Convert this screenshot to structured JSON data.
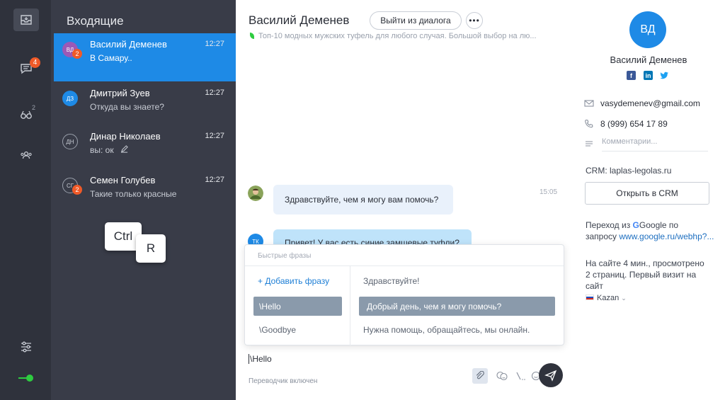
{
  "rail": {
    "chat_badge": "4",
    "visitors_sup": "2",
    "icons": [
      "inbox-icon",
      "chat-icon",
      "visitors-icon",
      "team-icon",
      "settings-sliders-icon"
    ]
  },
  "conversations": {
    "title": "Входящие",
    "items": [
      {
        "initials": "ВД",
        "badge": "2",
        "name": "Василий Деменев",
        "preview": "В Самару..",
        "time": "12:27"
      },
      {
        "initials": "ДЗ",
        "badge": "",
        "name": "Дмитрий Зуев",
        "preview": "Откуда вы знаете?",
        "time": "12:27"
      },
      {
        "initials": "ДН",
        "badge": "",
        "name": "Динар Николаев",
        "preview": "вы: ок",
        "time": "12:27"
      },
      {
        "initials": "СГ",
        "badge": "2",
        "name": "Семен Голубев",
        "preview": "Такие только красные",
        "time": "12:27"
      }
    ],
    "keys": [
      "Ctrl",
      "R"
    ]
  },
  "chat": {
    "name": "Василий Деменев",
    "exit_label": "Выйти из диалога",
    "more_label": "•••",
    "page_title": "Топ-10 модных мужских туфель для любого случая. Большой выбор на лю...",
    "messages": [
      {
        "text": "Здравствуйте, чем я могу вам помочь?",
        "time": "15:05"
      },
      {
        "initials": "ТК",
        "text": "Привет! У вас есть синие замшевые туфли?"
      }
    ],
    "quick_phrases": {
      "title": "Быстрые фразы",
      "add_label": "+ Добавить фразу",
      "shortcuts": [
        "\\Hello",
        "\\Goodbye"
      ],
      "phrases": [
        "Здравствуйте!",
        "Добрый день, чем я могу помочь?",
        "Нужна помощь, обращайтесь, мы онлайн."
      ]
    },
    "input_value": "\\Hello",
    "translator_status": "Переводчик включен"
  },
  "profile": {
    "initials": "ВД",
    "name": "Василий Деменев",
    "email": "vasydemenev@gmail.com",
    "phone": "8 (999) 654 17 89",
    "comment_placeholder": "Комментарии...",
    "crm_label": "CRM: laplas-legolas.ru",
    "crm_button": "Открыть в CRM",
    "source_prefix": "Переход из",
    "source_name": "Google по",
    "source_query_label": "запросу",
    "source_link": "www.google.ru/webhp?...",
    "visit_line1": "На сайте 4 мин., просмотрено",
    "visit_line2": "2 страниц. Первый визит на",
    "visit_line3": "сайт",
    "city": "Kazan",
    "colors": {
      "accent": "#1e8ae6",
      "facebook": "#3b5998",
      "linkedin": "#0077b5",
      "twitter": "#1da1f2"
    }
  }
}
